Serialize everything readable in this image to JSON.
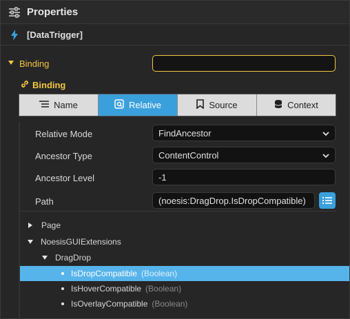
{
  "header": {
    "title": "Properties",
    "icon": "sliders-icon"
  },
  "subheader": {
    "label": "[DataTrigger]",
    "icon": "lightning-icon"
  },
  "binding": {
    "label": "Binding",
    "value": ""
  },
  "binding_section": {
    "label": "Binding",
    "icon": "link-icon"
  },
  "tabs": [
    {
      "label": "Name",
      "icon": "list-icon",
      "active": false
    },
    {
      "label": "Relative",
      "icon": "relative-icon",
      "active": true
    },
    {
      "label": "Source",
      "icon": "bookmark-icon",
      "active": false
    },
    {
      "label": "Context",
      "icon": "database-icon",
      "active": false
    }
  ],
  "props": {
    "relative_mode": {
      "label": "Relative Mode",
      "value": "FindAncestor"
    },
    "ancestor_type": {
      "label": "Ancestor Type",
      "value": "ContentControl"
    },
    "ancestor_level": {
      "label": "Ancestor Level",
      "value": "-1"
    },
    "path": {
      "label": "Path",
      "value": "(noesis:DragDrop.IsDropCompatible)"
    }
  },
  "tree": {
    "page": "Page",
    "ext": "NoesisGUIExtensions",
    "dragdrop": "DragDrop",
    "items": [
      {
        "name": "IsDropCompatible",
        "type": "(Boolean)"
      },
      {
        "name": "IsHoverCompatible",
        "type": "(Boolean)"
      },
      {
        "name": "IsOverlayCompatible",
        "type": "(Boolean)"
      }
    ]
  },
  "colors": {
    "accent": "#3aa0dc",
    "highlight": "#f2c744",
    "selected": "#56b4ea"
  }
}
